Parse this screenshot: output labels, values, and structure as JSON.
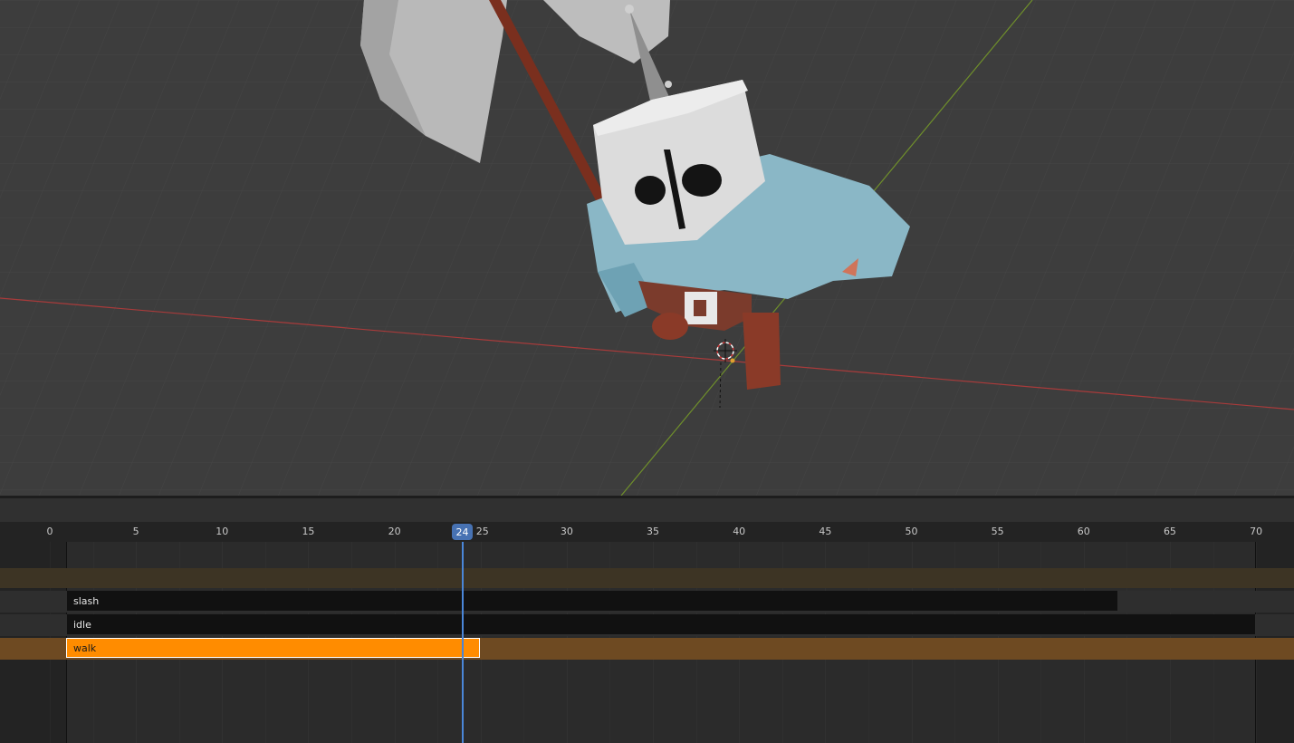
{
  "editor": {
    "type": "NLA Editor",
    "current_frame": "24",
    "ruler_ticks": [
      "0",
      "5",
      "10",
      "15",
      "20",
      "25",
      "30",
      "35",
      "40",
      "45",
      "50",
      "55",
      "60",
      "65",
      "70"
    ],
    "scene_range": [
      0,
      70
    ]
  },
  "tracks": [
    {
      "name": "slash",
      "strip_label": "slash",
      "start": 1,
      "end": 62,
      "state": "inactive"
    },
    {
      "name": "idle",
      "strip_label": "idle",
      "start": 1,
      "end": 70,
      "state": "inactive"
    },
    {
      "name": "walk",
      "strip_label": "walk",
      "start": 1,
      "end": 25,
      "state": "active"
    }
  ],
  "colors": {
    "viewport_bg": "#3d3d3d",
    "x_axis": "#a83b3b",
    "y_axis": "#6f8f2b",
    "active_strip": "#ff8c00",
    "active_track_bg": "#6e4a22",
    "inactive_strip": "#111111",
    "playhead": "#4772b3"
  },
  "viewport": {
    "object": "knight character with axe",
    "icons": [
      "origin-gizmo-icon"
    ]
  }
}
